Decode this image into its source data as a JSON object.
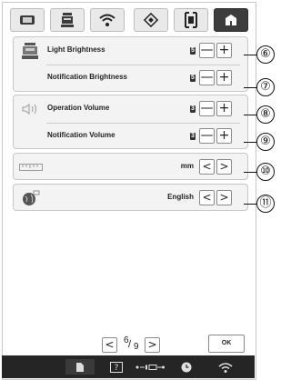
{
  "settings": {
    "light_brightness_label": "Light Brightness",
    "light_brightness_value": "5",
    "notification_brightness_label": "Notification Brightness",
    "notification_brightness_value": "5",
    "operation_volume_label": "Operation Volume",
    "operation_volume_value": "3",
    "notification_volume_label": "Notification Volume",
    "notification_volume_value": "3",
    "unit_value": "mm",
    "language_value": "English"
  },
  "buttons": {
    "minus": "—",
    "plus": "+",
    "prev": "<",
    "next": ">",
    "ok": "OK"
  },
  "pager": {
    "current": "6",
    "total": "9"
  },
  "callouts": [
    "⑥",
    "⑦",
    "⑧",
    "⑨",
    "⑩",
    "⑪"
  ],
  "icons": {
    "tabs": [
      "embroidery-frame-icon",
      "machine-icon",
      "wifi-icon",
      "diamond-icon",
      "frame-icon",
      "home-icon"
    ],
    "status": [
      "document-icon",
      "help-icon",
      "frame-connector-icon",
      "clock-icon",
      "wifi-icon"
    ]
  },
  "colors": {
    "active_tab": "#3d3d3d",
    "status_bar": "#252525",
    "panel_bg": "#f3f3f3"
  }
}
